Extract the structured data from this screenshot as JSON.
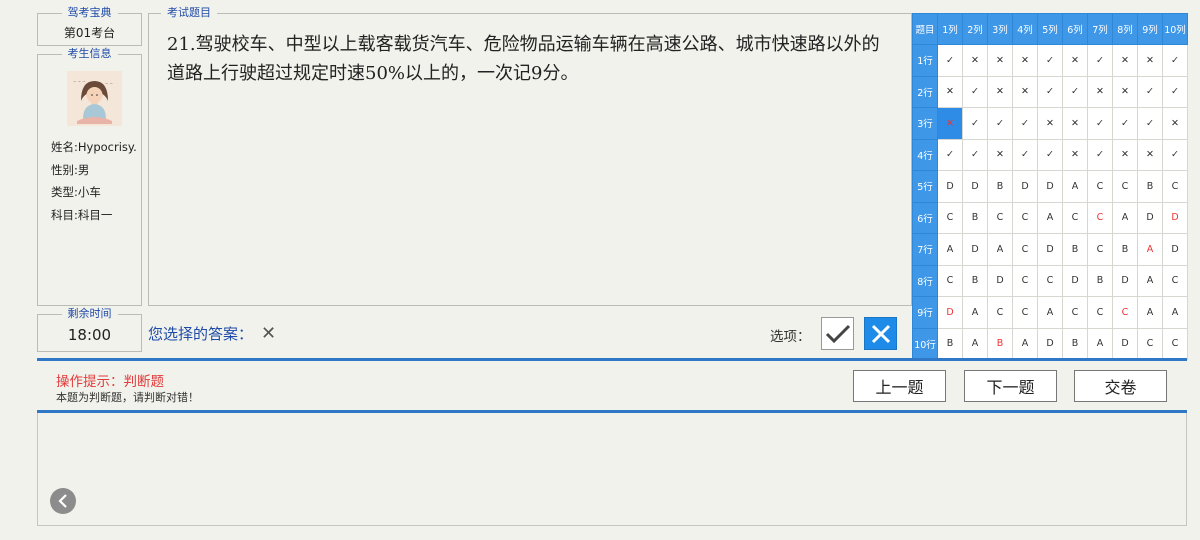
{
  "app": {
    "name": "驾考宝典",
    "seat": "第01考台"
  },
  "examinee": {
    "legend": "考生信息",
    "name": "姓名:Hypocrisy.",
    "gender": "性别:男",
    "type": "类型:小车",
    "subject": "科目:科目一"
  },
  "question": {
    "legend": "考试题目",
    "text": "21.驾驶校车、中型以上载客载货汽车、危险物品运输车辆在高速公路、城市快速路以外的道路上行驶超过规定时速50%以上的，一次记9分。"
  },
  "timer": {
    "legend": "剩余时间",
    "value": "18:00"
  },
  "answer": {
    "label": "您选择的答案：",
    "value": "✕"
  },
  "options": {
    "label": "选项：",
    "true_icon": "check-icon",
    "false_icon": "cross-icon"
  },
  "grid": {
    "corner": "题目",
    "columns": [
      "1列",
      "2列",
      "3列",
      "4列",
      "5列",
      "6列",
      "7列",
      "8列",
      "9列",
      "10列"
    ],
    "rows": [
      {
        "label": "1行",
        "cells": [
          "✓",
          "✕",
          "✕",
          "✕",
          "✓",
          "✕",
          "✓",
          "✕",
          "✕",
          "✓"
        ]
      },
      {
        "label": "2行",
        "cells": [
          "✕",
          "✓",
          "✕",
          "✕",
          "✓",
          "✓",
          "✕",
          "✕",
          "✓",
          "✓"
        ]
      },
      {
        "label": "3行",
        "cells": [
          "✕",
          "✓",
          "✓",
          "✓",
          "✕",
          "✕",
          "✓",
          "✓",
          "✓",
          "✕"
        ]
      },
      {
        "label": "4行",
        "cells": [
          "✓",
          "✓",
          "✕",
          "✓",
          "✓",
          "✕",
          "✓",
          "✕",
          "✕",
          "✓"
        ]
      },
      {
        "label": "5行",
        "cells": [
          "D",
          "D",
          "B",
          "D",
          "D",
          "A",
          "C",
          "C",
          "B",
          "C"
        ]
      },
      {
        "label": "6行",
        "cells": [
          "C",
          "B",
          "C",
          "C",
          "A",
          "C",
          "C",
          "A",
          "D",
          "D"
        ]
      },
      {
        "label": "7行",
        "cells": [
          "A",
          "D",
          "A",
          "C",
          "D",
          "B",
          "C",
          "B",
          "A",
          "D"
        ]
      },
      {
        "label": "8行",
        "cells": [
          "C",
          "B",
          "D",
          "C",
          "C",
          "D",
          "B",
          "D",
          "A",
          "C"
        ]
      },
      {
        "label": "9行",
        "cells": [
          "D",
          "A",
          "C",
          "C",
          "A",
          "C",
          "C",
          "C",
          "A",
          "A"
        ]
      },
      {
        "label": "10行",
        "cells": [
          "B",
          "A",
          "B",
          "A",
          "D",
          "B",
          "A",
          "D",
          "C",
          "C"
        ]
      }
    ],
    "wrong": [
      "2-0",
      "5-6",
      "5-9",
      "6-8",
      "8-0",
      "8-7",
      "9-2"
    ],
    "current": "2-0",
    "colors": {
      "header": "#3f97e8",
      "wrong": "#e33333",
      "current": "#2f8ce6"
    }
  },
  "hint": {
    "title": "操作提示：判断题",
    "text": "本题为判断题，请判断对错！"
  },
  "nav": {
    "prev": "上一题",
    "next": "下一题",
    "submit": "交卷"
  },
  "back": {
    "icon": "chevron-left-icon"
  }
}
